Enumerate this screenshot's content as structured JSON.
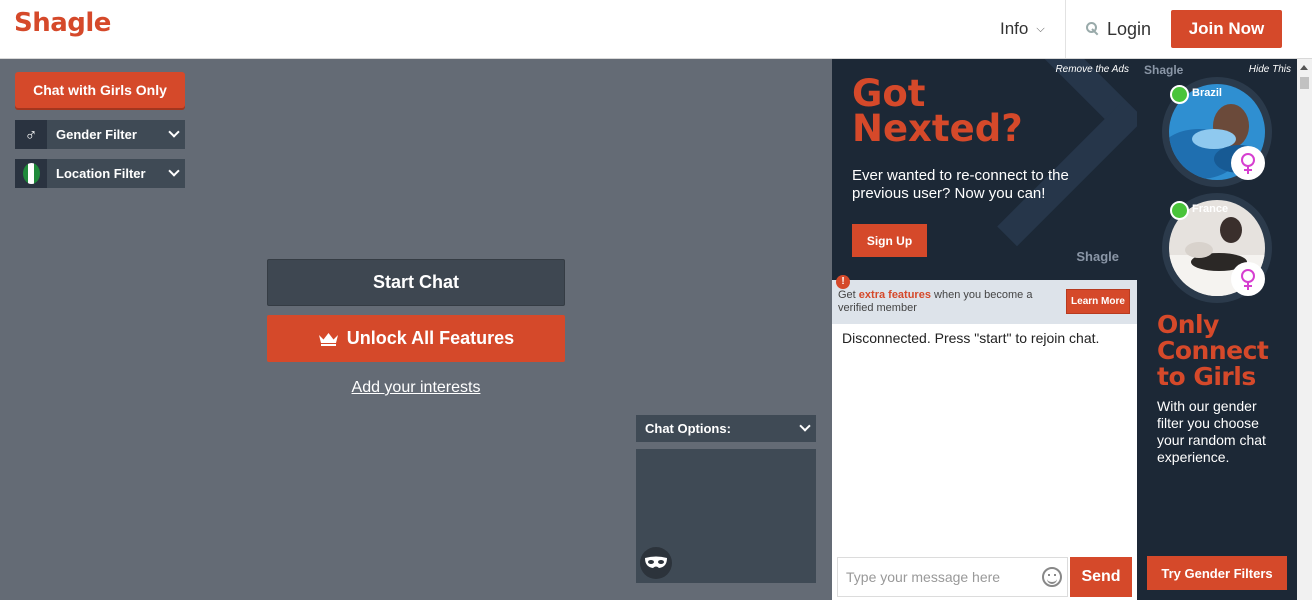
{
  "header": {
    "logo": "Shagle",
    "info_label": "Info",
    "login_label": "Login",
    "join_label": "Join Now"
  },
  "filters": {
    "girls_only_label": "Chat with Girls Only",
    "gender_label": "Gender Filter",
    "location_label": "Location Filter"
  },
  "main": {
    "start_label": "Start Chat",
    "unlock_label": "Unlock All Features",
    "interests_label": "Add your interests",
    "chat_options_label": "Chat Options:"
  },
  "ad_top": {
    "remove_label": "Remove the Ads",
    "title_line1": "Got",
    "title_line2": "Nexted?",
    "description": "Ever wanted to re-connect to the previous user? Now you can!",
    "signup_label": "Sign Up",
    "brand": "Shagle"
  },
  "verify": {
    "text_pre": "Get ",
    "text_highlight": "extra features",
    "text_post": " when you become a verified member",
    "learn_label": "Learn More"
  },
  "chat": {
    "status": "Disconnected. Press \"start\" to rejoin chat.",
    "input_placeholder": "Type your message here",
    "send_label": "Send"
  },
  "ad_right": {
    "brand": "Shagle",
    "hide_label": "Hide This",
    "profiles": [
      {
        "country": "Brazil"
      },
      {
        "country": "France"
      }
    ],
    "headline": "Only Connect to Girls",
    "subtext": "With our gender filter you choose your random chat experience.",
    "try_label": "Try Gender Filters"
  },
  "colors": {
    "accent": "#d5492a",
    "background": "#646b75",
    "panel": "#3f4a55",
    "ad_bg": "#1c2836",
    "online": "#49c43a",
    "female": "#d63fd0"
  }
}
